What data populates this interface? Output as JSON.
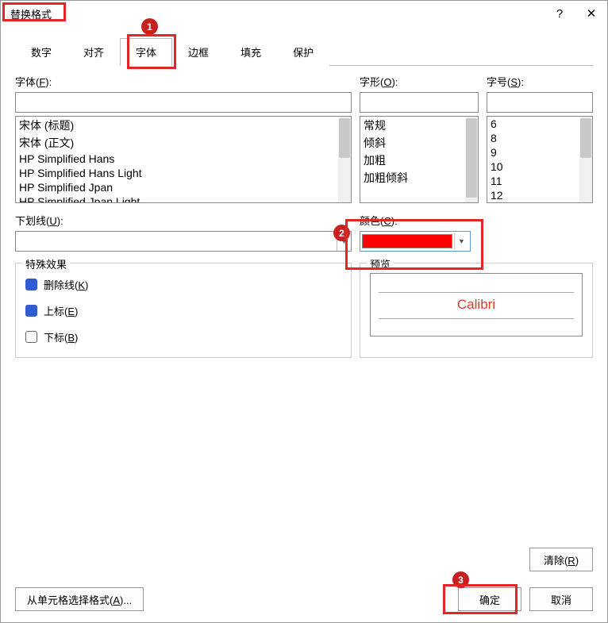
{
  "title": "替换格式",
  "help_icon": "?",
  "close_icon": "✕",
  "tabs": {
    "number": "数字",
    "align": "对齐",
    "font": "字体",
    "border": "边框",
    "fill": "填充",
    "protect": "保护"
  },
  "labels": {
    "font": "字体(",
    "font_hotkey": "F",
    "font_end": "):",
    "style": "字形(",
    "style_hotkey": "O",
    "style_end": "):",
    "size": "字号(",
    "size_hotkey": "S",
    "size_end": "):",
    "underline": "下划线(",
    "underline_hotkey": "U",
    "underline_end": "):",
    "color": "颜色(",
    "color_hotkey": "C",
    "color_end": "):",
    "effects": "特殊效果",
    "preview": "预览",
    "strikethrough": "删除线(",
    "strikethrough_hotkey": "K",
    "strikethrough_end": ")",
    "superscript": "上标(",
    "superscript_hotkey": "E",
    "superscript_end": ")",
    "subscript": "下标(",
    "subscript_hotkey": "B",
    "subscript_end": ")"
  },
  "font_list": [
    "宋体 (标题)",
    "宋体 (正文)",
    "HP Simplified Hans",
    "HP Simplified Hans Light",
    "HP Simplified Jpan",
    "HP Simplified Jpan Light"
  ],
  "style_list": [
    "常规",
    "倾斜",
    "加粗",
    "加粗倾斜"
  ],
  "size_list": [
    "6",
    "8",
    "9",
    "10",
    "11",
    "12"
  ],
  "color_value": "#ff0000",
  "preview_text": "Calibri",
  "buttons": {
    "clear": "清除(",
    "clear_hotkey": "R",
    "clear_end": ")",
    "from_cell": "从单元格选择格式(",
    "from_cell_hotkey": "A",
    "from_cell_end": ")...",
    "ok": "确定",
    "cancel": "取消"
  },
  "badges": {
    "b1": "1",
    "b2": "2",
    "b3": "3"
  }
}
